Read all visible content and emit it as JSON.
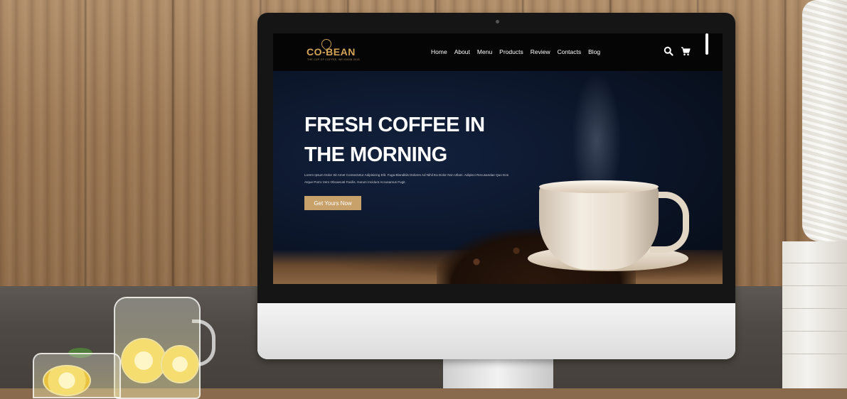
{
  "site": {
    "logo": "CO-BEAN",
    "logo_tagline": "THE CUP OF COFFEE, WE KNOW 2018",
    "nav": [
      "Home",
      "About",
      "Menu",
      "Products",
      "Review",
      "Contacts",
      "Blog"
    ],
    "icons": [
      "search-icon",
      "cart-icon"
    ]
  },
  "hero": {
    "title_line1": "FRESH COFFEE IN",
    "title_line2": "THE MORNING",
    "body": "Lorem Ipsum Dolor Sit Amet Consectetur Adipisicing Elit. Fuga Blanditiis Dolores Ad Nihil Ea Dolor Non Ullam. Adipisci Recusandae Quo Eos Atque Porro Vero Obcaecati Facilis. Harum Incidunt Accusamus Fugit.",
    "cta": "Get Yours Now"
  },
  "colors": {
    "accent": "#c8a06a",
    "logo": "#d4a458",
    "nav_bg": "#050505",
    "hero_bg": "#0b1528"
  }
}
